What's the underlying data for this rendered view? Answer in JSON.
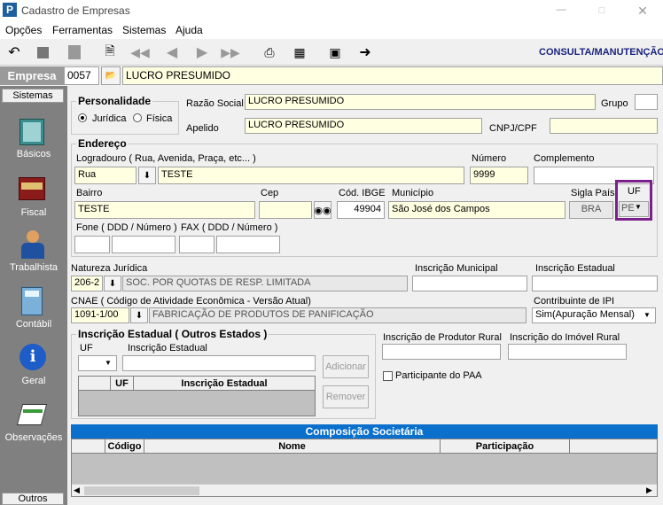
{
  "window": {
    "title": "Cadastro de Empresas"
  },
  "menu": [
    "Opções",
    "Ferramentas",
    "Sistemas",
    "Ajuda"
  ],
  "toolbar": {
    "mode_label": "CONSULTA/MANUTENÇÃO"
  },
  "empresa": {
    "label": "Empresa",
    "code": "0057",
    "name": "LUCRO PRESUMIDO"
  },
  "sidebar": {
    "header": "Sistemas",
    "items": [
      {
        "label": "Básicos",
        "icon": "book-icon"
      },
      {
        "label": "Fiscal",
        "icon": "fiscal-book-icon"
      },
      {
        "label": "Trabalhista",
        "icon": "worker-icon"
      },
      {
        "label": "Contábil",
        "icon": "calculator-icon"
      },
      {
        "label": "Geral",
        "icon": "info-icon"
      },
      {
        "label": "Observações",
        "icon": "notes-icon"
      }
    ],
    "footer": "Outros"
  },
  "personalidade": {
    "title": "Personalidade",
    "juridica": "Jurídica",
    "fisica": "Física",
    "selected": "juridica"
  },
  "fields": {
    "razao_social_label": "Razão Social",
    "razao_social": "LUCRO PRESUMIDO",
    "grupo_label": "Grupo",
    "grupo": "",
    "apelido_label": "Apelido",
    "apelido": "LUCRO PRESUMIDO",
    "cnpj_label": "CNPJ/CPF",
    "cnpj": ""
  },
  "endereco": {
    "title": "Endereço",
    "logradouro_label": "Logradouro ( Rua, Avenida, Praça, etc... )",
    "logradouro_tipo": "Rua",
    "logradouro": "TESTE",
    "numero_label": "Número",
    "numero": "9999",
    "complemento_label": "Complemento",
    "complemento": "",
    "bairro_label": "Bairro",
    "bairro": "TESTE",
    "cep_label": "Cep",
    "cep": "",
    "ibge_label": "Cód. IBGE",
    "ibge": "49904",
    "municipio_label": "Município",
    "municipio": "São José dos Campos",
    "sigla_pais_label": "Sigla País",
    "sigla_pais": "BRA",
    "uf_label": "UF",
    "uf": "PE",
    "fone_label": "Fone ( DDD / Número )",
    "fax_label": "FAX ( DDD / Número )"
  },
  "natureza": {
    "label": "Natureza Jurídica",
    "code": "206-2",
    "desc": "SOC. POR QUOTAS DE RESP. LIMITADA"
  },
  "insc_municipal_label": "Inscrição Municipal",
  "insc_estadual_label": "Inscrição Estadual",
  "cnae": {
    "label": "CNAE ( Código de Atividade Econômica - Versão Atual)",
    "code": "1091-1/00",
    "desc": "FABRICAÇÃO DE PRODUTOS DE PANIFICAÇÃO"
  },
  "contribuinte_ipi": {
    "label": "Contribuinte de IPI",
    "value": "Sim(Apuração Mensal)"
  },
  "outros_estados": {
    "title": "Inscrição Estadual ( Outros Estados )",
    "uf_label": "UF",
    "ie_label": "Inscrição Estadual",
    "col_uf": "UF",
    "col_ie": "Inscrição Estadual",
    "adicionar": "Adicionar",
    "remover": "Remover"
  },
  "produtor_rural_label": "Inscrição de Produtor Rural",
  "imovel_rural_label": "Inscrição do Imóvel Rural",
  "paa_label": "Participante do PAA",
  "composicao": {
    "title": "Composição Societária",
    "col_codigo": "Código",
    "col_nome": "Nome",
    "col_participacao": "Participação"
  }
}
